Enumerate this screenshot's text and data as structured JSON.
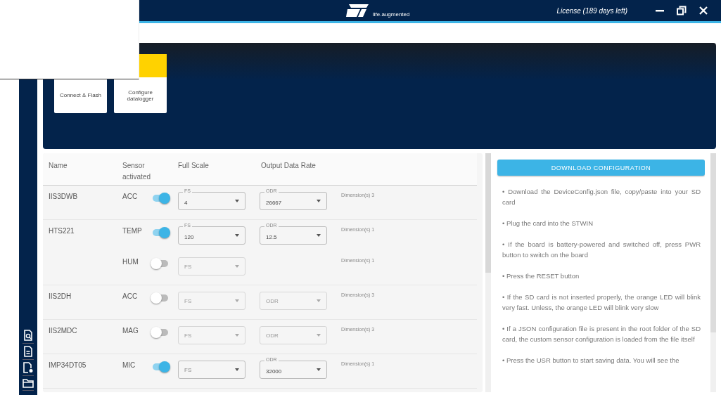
{
  "header": {
    "tagline": "life.augmented",
    "license": "License (189 days left)"
  },
  "steps": [
    {
      "label": "Connect & Flash"
    },
    {
      "label": "Configure datalogger",
      "color": "#ffd200"
    }
  ],
  "table": {
    "columns": [
      "Name",
      "Sensor activated",
      "Full Scale",
      "Output Data Rate"
    ],
    "sensors": [
      {
        "name": "IIS3DWB",
        "subsensors": [
          {
            "type": "ACC",
            "active": true,
            "fs": {
              "placeholder": "FS",
              "value": "4"
            },
            "odr": {
              "placeholder": "ODR",
              "value": "26667"
            },
            "dimensions": "Dimension(s) 3"
          }
        ]
      },
      {
        "name": "HTS221",
        "subsensors": [
          {
            "type": "TEMP",
            "active": true,
            "fs": {
              "placeholder": "FS",
              "value": "120"
            },
            "odr": {
              "placeholder": "ODR",
              "value": "12.5"
            },
            "dimensions": "Dimension(s) 1"
          },
          {
            "type": "HUM",
            "active": false,
            "fs": {
              "placeholder": "FS"
            },
            "dimensions": "Dimension(s) 1"
          }
        ]
      },
      {
        "name": "IIS2DH",
        "subsensors": [
          {
            "type": "ACC",
            "active": false,
            "fs": {
              "placeholder": "FS"
            },
            "odr": {
              "placeholder": "ODR"
            },
            "dimensions": "Dimension(s) 3"
          }
        ]
      },
      {
        "name": "IIS2MDC",
        "subsensors": [
          {
            "type": "MAG",
            "active": false,
            "fs": {
              "placeholder": "FS"
            },
            "odr": {
              "placeholder": "ODR"
            },
            "dimensions": "Dimension(s) 3"
          }
        ]
      },
      {
        "name": "IMP34DT05",
        "subsensors": [
          {
            "type": "MIC",
            "active": true,
            "fs": {
              "placeholder": "FS"
            },
            "odr": {
              "placeholder": "ODR",
              "value": "32000"
            },
            "dimensions": "Dimension(s) 1"
          }
        ]
      }
    ]
  },
  "download_button": "DOWNLOAD CONFIGURATION",
  "instructions": [
    "• Download the DeviceConfig.json file, copy/paste into your SD card",
    "• Plug the card into the STWIN",
    "• If the board is battery-powered and switched off, press PWR button to switch on the board",
    "• Press the RESET button",
    "• If the SD card is not inserted properly, the orange LED will blink very fast. Unless, the orange LED will blink very slow",
    "• If a JSON configuration file is present in the root folder of the SD card, the custom sensor configuration is loaded from the file itself",
    "• Press the USR button to start saving data. You will see the"
  ]
}
